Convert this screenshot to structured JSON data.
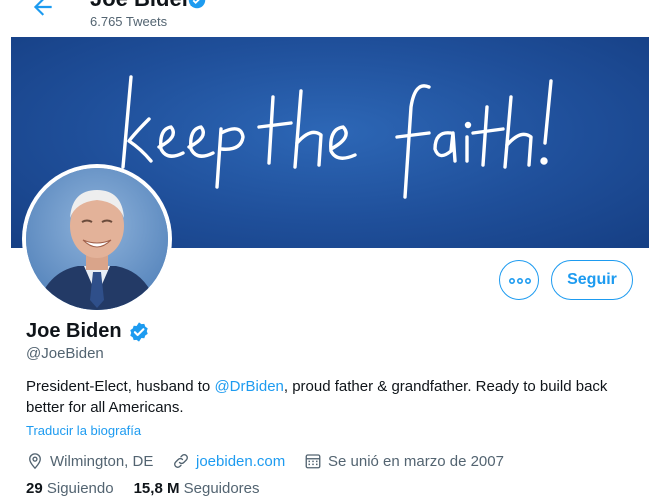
{
  "header": {
    "title": "Joe Biden",
    "tweet_count": "6.765 Tweets"
  },
  "banner": {
    "text": "keep the faith!"
  },
  "actions": {
    "follow_label": "Seguir"
  },
  "profile": {
    "name": "Joe Biden",
    "handle": "@JoeBiden",
    "bio_before": "President-Elect, husband to ",
    "bio_mention": "@DrBiden",
    "bio_after": ", proud father & grandfather. Ready to build back better for all Americans.",
    "translate_label": "Traducir la biografía",
    "location": "Wilmington, DE",
    "website": "joebiden.com",
    "joined": "Se unió en marzo de 2007",
    "following_count": "29",
    "following_label": "Siguiendo",
    "followers_count": "15,8 M",
    "followers_label": "Seguidores"
  },
  "colors": {
    "accent": "#1d9bf0",
    "banner": "#1f4f9a",
    "secondary_text": "#536471"
  },
  "icons": [
    "back-arrow-icon",
    "verified-badge-icon",
    "more-dots-icon",
    "location-icon",
    "link-icon",
    "calendar-icon"
  ]
}
